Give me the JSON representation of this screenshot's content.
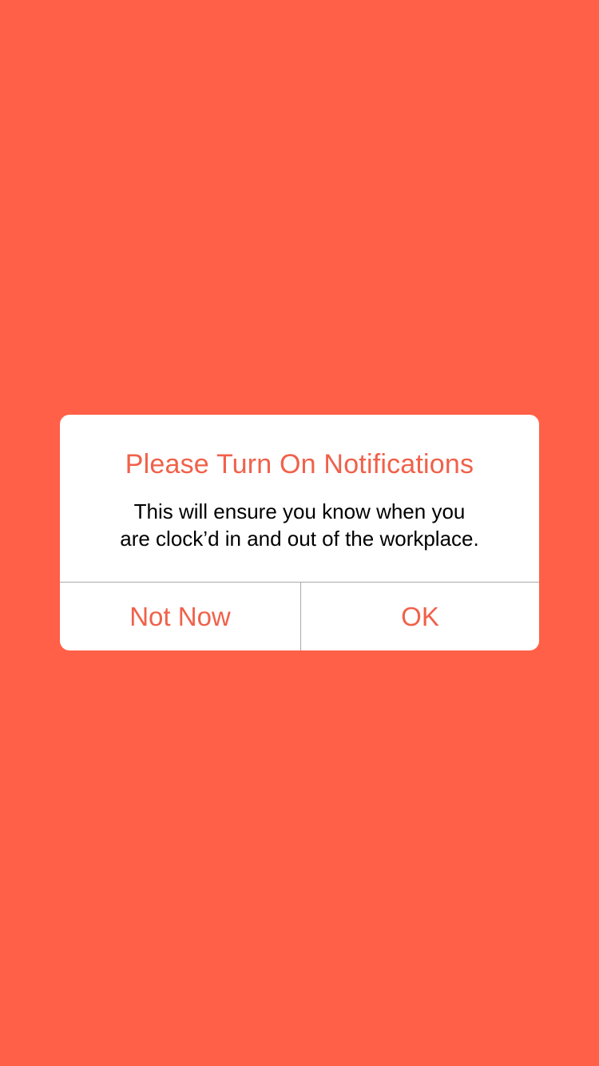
{
  "colors": {
    "background": "#FF6047",
    "accent": "#F0614A",
    "alert_background": "#FFFFFF",
    "message_text": "#000000",
    "divider": "#A9A9AD"
  },
  "alert": {
    "title": "Please Turn On Notifications",
    "message_lines": [
      "This will ensure you know when you",
      "are clock’d in and out of the workplace."
    ],
    "buttons": {
      "secondary_label": "Not Now",
      "primary_label": "OK"
    }
  }
}
